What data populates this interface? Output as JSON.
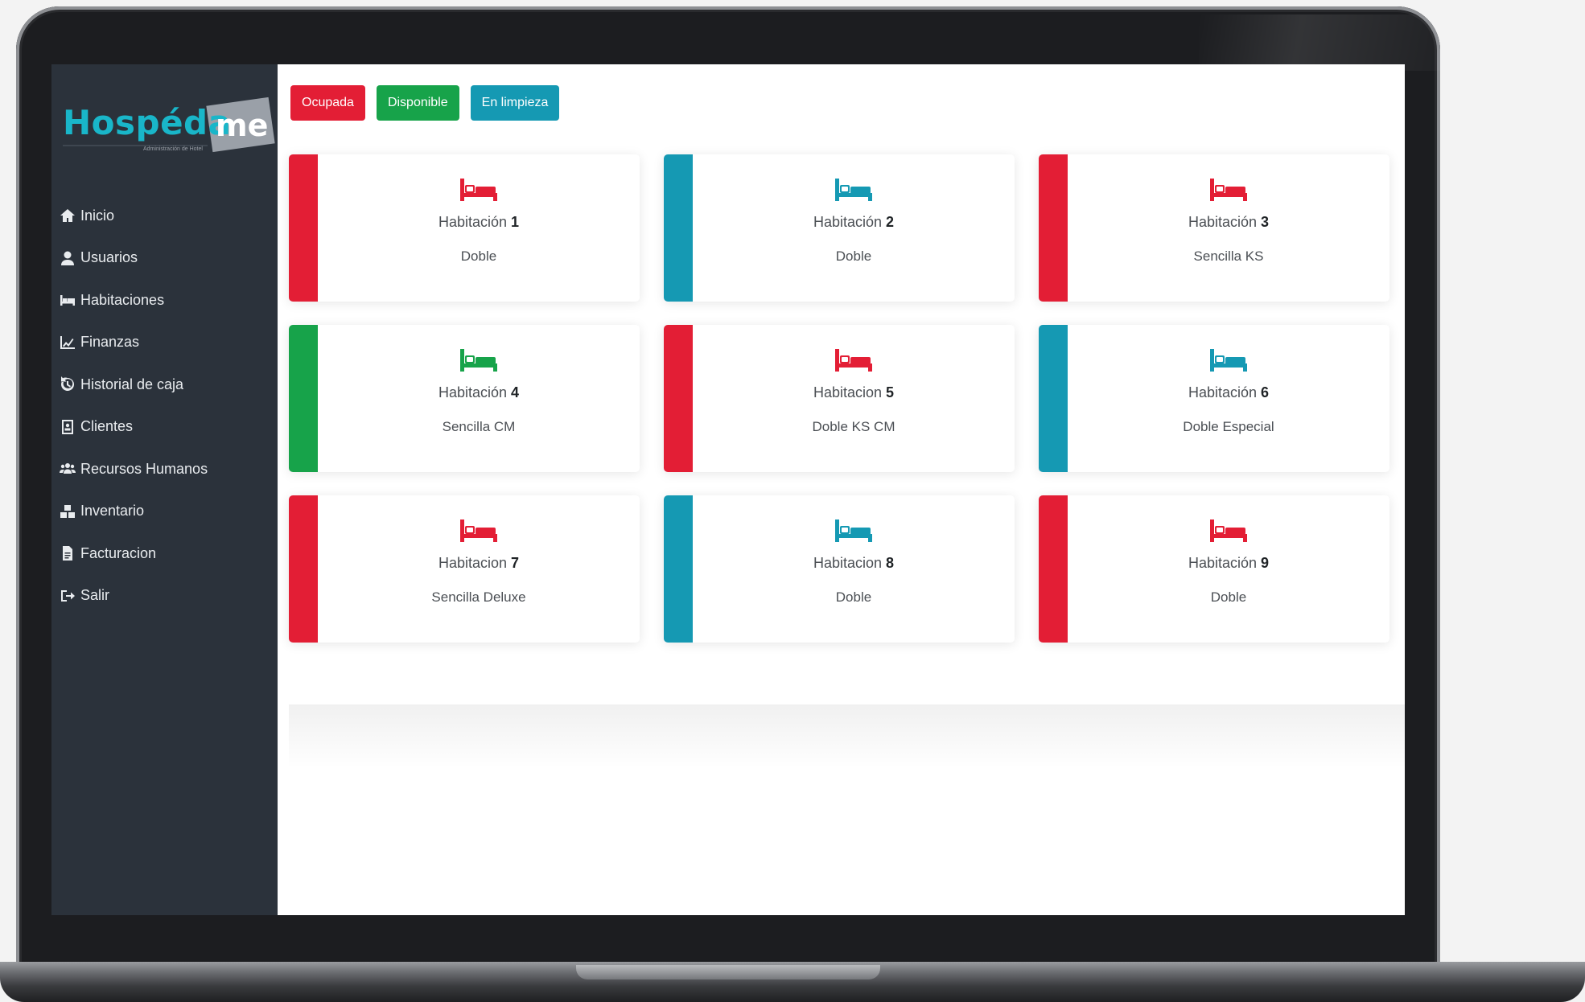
{
  "app": {
    "logo_text": "Hospédame",
    "logo_word": "Hospéda",
    "logo_suffix": "me",
    "logo_tagline": "Administración de Hotel"
  },
  "sidebar": {
    "items": [
      {
        "label": "Inicio",
        "icon": "home-icon"
      },
      {
        "label": "Usuarios",
        "icon": "user-icon"
      },
      {
        "label": "Habitaciones",
        "icon": "bed-icon"
      },
      {
        "label": "Finanzas",
        "icon": "chart-icon"
      },
      {
        "label": "Historial de caja",
        "icon": "history-icon"
      },
      {
        "label": "Clientes",
        "icon": "contact-card-icon"
      },
      {
        "label": "Recursos Humanos",
        "icon": "users-icon"
      },
      {
        "label": "Inventario",
        "icon": "boxes-icon"
      },
      {
        "label": "Facturacion",
        "icon": "invoice-icon"
      },
      {
        "label": "Salir",
        "icon": "sign-out-icon"
      }
    ]
  },
  "legend": {
    "occupied": "Ocupada",
    "available": "Disponible",
    "cleaning": "En limpieza"
  },
  "colors": {
    "occupied": "#e31e35",
    "available": "#17a34a",
    "cleaning": "#1599b3",
    "sidebar": "#2b323b",
    "logo": "#19b6c9"
  },
  "rooms": [
    {
      "label": "Habitación",
      "number": "1",
      "type": "Doble",
      "status": "occupied"
    },
    {
      "label": "Habitación",
      "number": "2",
      "type": "Doble",
      "status": "cleaning"
    },
    {
      "label": "Habitación",
      "number": "3",
      "type": "Sencilla KS",
      "status": "occupied"
    },
    {
      "label": "Habitación",
      "number": "4",
      "type": "Sencilla CM",
      "status": "available"
    },
    {
      "label": "Habitacion",
      "number": "5",
      "type": "Doble KS CM",
      "status": "occupied"
    },
    {
      "label": "Habitación",
      "number": "6",
      "type": "Doble Especial",
      "status": "cleaning"
    },
    {
      "label": "Habitacion",
      "number": "7",
      "type": "Sencilla Deluxe",
      "status": "occupied"
    },
    {
      "label": "Habitacion",
      "number": "8",
      "type": "Doble",
      "status": "cleaning"
    },
    {
      "label": "Habitación",
      "number": "9",
      "type": "Doble",
      "status": "occupied"
    }
  ]
}
